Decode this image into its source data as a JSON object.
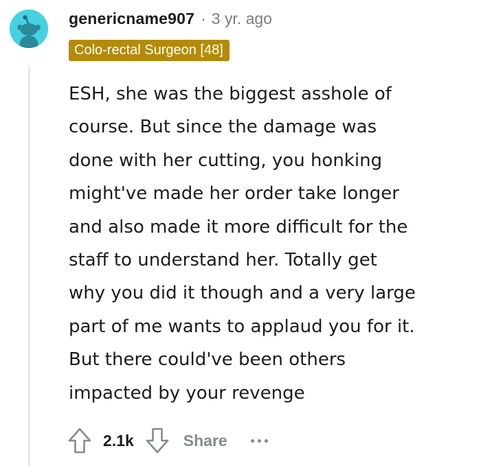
{
  "comment": {
    "author": "genericname907",
    "separator": "·",
    "timestamp": "3 yr. ago",
    "flair": "Colo-rectal Surgeon [48]",
    "body_lines": [
      "ESH, she was the biggest asshole of",
      "course. But since the damage was",
      "done with her cutting, you honking",
      "might've made her order take longer",
      "and also made it more difficult for the",
      "staff to understand her. Totally get",
      "why you did it though and a very large",
      "part of me wants to applaud you for it.",
      "But there could've been others",
      "impacted by your revenge"
    ],
    "score": "2.1k",
    "share_label": "Share"
  },
  "icons": {
    "avatar": "snoo-avatar-icon",
    "upvote": "upvote-arrow-icon",
    "downvote": "downvote-arrow-icon",
    "more": "more-options-icon"
  },
  "colors": {
    "avatar_bg": "#46d1e0",
    "flair_bg": "#b48a0a",
    "meta_gray": "#7c7c7c",
    "action_gray": "#878a8c",
    "thread_line": "#e6e8ea"
  }
}
